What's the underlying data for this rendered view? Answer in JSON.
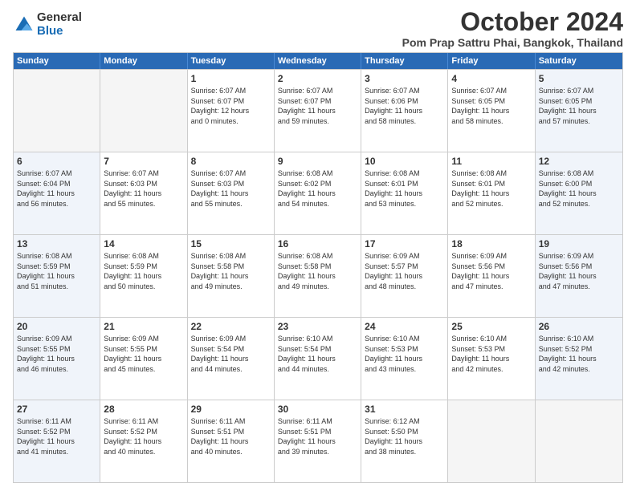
{
  "logo": {
    "general": "General",
    "blue": "Blue"
  },
  "title": {
    "month": "October 2024",
    "location": "Pom Prap Sattru Phai, Bangkok, Thailand"
  },
  "headers": [
    "Sunday",
    "Monday",
    "Tuesday",
    "Wednesday",
    "Thursday",
    "Friday",
    "Saturday"
  ],
  "weeks": [
    [
      {
        "day": "",
        "text": "",
        "empty": true
      },
      {
        "day": "",
        "text": "",
        "empty": true
      },
      {
        "day": "1",
        "text": "Sunrise: 6:07 AM\nSunset: 6:07 PM\nDaylight: 12 hours\nand 0 minutes."
      },
      {
        "day": "2",
        "text": "Sunrise: 6:07 AM\nSunset: 6:07 PM\nDaylight: 11 hours\nand 59 minutes."
      },
      {
        "day": "3",
        "text": "Sunrise: 6:07 AM\nSunset: 6:06 PM\nDaylight: 11 hours\nand 58 minutes."
      },
      {
        "day": "4",
        "text": "Sunrise: 6:07 AM\nSunset: 6:05 PM\nDaylight: 11 hours\nand 58 minutes."
      },
      {
        "day": "5",
        "text": "Sunrise: 6:07 AM\nSunset: 6:05 PM\nDaylight: 11 hours\nand 57 minutes."
      }
    ],
    [
      {
        "day": "6",
        "text": "Sunrise: 6:07 AM\nSunset: 6:04 PM\nDaylight: 11 hours\nand 56 minutes."
      },
      {
        "day": "7",
        "text": "Sunrise: 6:07 AM\nSunset: 6:03 PM\nDaylight: 11 hours\nand 55 minutes."
      },
      {
        "day": "8",
        "text": "Sunrise: 6:07 AM\nSunset: 6:03 PM\nDaylight: 11 hours\nand 55 minutes."
      },
      {
        "day": "9",
        "text": "Sunrise: 6:08 AM\nSunset: 6:02 PM\nDaylight: 11 hours\nand 54 minutes."
      },
      {
        "day": "10",
        "text": "Sunrise: 6:08 AM\nSunset: 6:01 PM\nDaylight: 11 hours\nand 53 minutes."
      },
      {
        "day": "11",
        "text": "Sunrise: 6:08 AM\nSunset: 6:01 PM\nDaylight: 11 hours\nand 52 minutes."
      },
      {
        "day": "12",
        "text": "Sunrise: 6:08 AM\nSunset: 6:00 PM\nDaylight: 11 hours\nand 52 minutes."
      }
    ],
    [
      {
        "day": "13",
        "text": "Sunrise: 6:08 AM\nSunset: 5:59 PM\nDaylight: 11 hours\nand 51 minutes."
      },
      {
        "day": "14",
        "text": "Sunrise: 6:08 AM\nSunset: 5:59 PM\nDaylight: 11 hours\nand 50 minutes."
      },
      {
        "day": "15",
        "text": "Sunrise: 6:08 AM\nSunset: 5:58 PM\nDaylight: 11 hours\nand 49 minutes."
      },
      {
        "day": "16",
        "text": "Sunrise: 6:08 AM\nSunset: 5:58 PM\nDaylight: 11 hours\nand 49 minutes."
      },
      {
        "day": "17",
        "text": "Sunrise: 6:09 AM\nSunset: 5:57 PM\nDaylight: 11 hours\nand 48 minutes."
      },
      {
        "day": "18",
        "text": "Sunrise: 6:09 AM\nSunset: 5:56 PM\nDaylight: 11 hours\nand 47 minutes."
      },
      {
        "day": "19",
        "text": "Sunrise: 6:09 AM\nSunset: 5:56 PM\nDaylight: 11 hours\nand 47 minutes."
      }
    ],
    [
      {
        "day": "20",
        "text": "Sunrise: 6:09 AM\nSunset: 5:55 PM\nDaylight: 11 hours\nand 46 minutes."
      },
      {
        "day": "21",
        "text": "Sunrise: 6:09 AM\nSunset: 5:55 PM\nDaylight: 11 hours\nand 45 minutes."
      },
      {
        "day": "22",
        "text": "Sunrise: 6:09 AM\nSunset: 5:54 PM\nDaylight: 11 hours\nand 44 minutes."
      },
      {
        "day": "23",
        "text": "Sunrise: 6:10 AM\nSunset: 5:54 PM\nDaylight: 11 hours\nand 44 minutes."
      },
      {
        "day": "24",
        "text": "Sunrise: 6:10 AM\nSunset: 5:53 PM\nDaylight: 11 hours\nand 43 minutes."
      },
      {
        "day": "25",
        "text": "Sunrise: 6:10 AM\nSunset: 5:53 PM\nDaylight: 11 hours\nand 42 minutes."
      },
      {
        "day": "26",
        "text": "Sunrise: 6:10 AM\nSunset: 5:52 PM\nDaylight: 11 hours\nand 42 minutes."
      }
    ],
    [
      {
        "day": "27",
        "text": "Sunrise: 6:11 AM\nSunset: 5:52 PM\nDaylight: 11 hours\nand 41 minutes."
      },
      {
        "day": "28",
        "text": "Sunrise: 6:11 AM\nSunset: 5:52 PM\nDaylight: 11 hours\nand 40 minutes."
      },
      {
        "day": "29",
        "text": "Sunrise: 6:11 AM\nSunset: 5:51 PM\nDaylight: 11 hours\nand 40 minutes."
      },
      {
        "day": "30",
        "text": "Sunrise: 6:11 AM\nSunset: 5:51 PM\nDaylight: 11 hours\nand 39 minutes."
      },
      {
        "day": "31",
        "text": "Sunrise: 6:12 AM\nSunset: 5:50 PM\nDaylight: 11 hours\nand 38 minutes."
      },
      {
        "day": "",
        "text": "",
        "empty": true
      },
      {
        "day": "",
        "text": "",
        "empty": true
      }
    ]
  ]
}
